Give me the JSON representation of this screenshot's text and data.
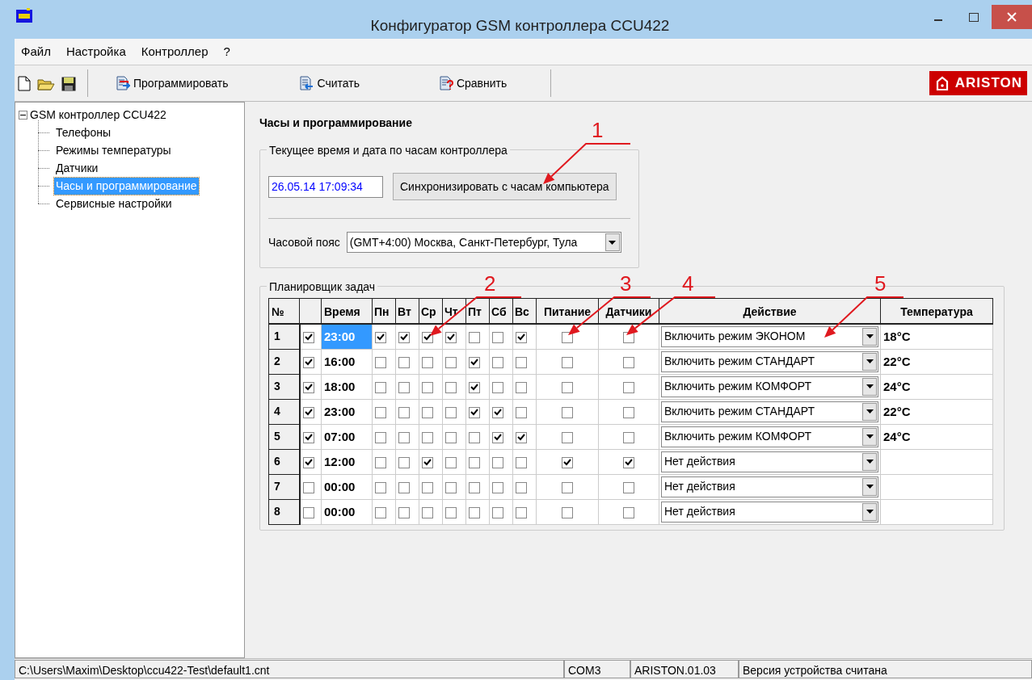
{
  "window": {
    "title": "Конфигуратор GSM контроллера CCU422"
  },
  "menu": [
    {
      "label": "Файл"
    },
    {
      "label": "Настройка"
    },
    {
      "label": "Контроллер"
    },
    {
      "label": "?"
    }
  ],
  "toolbar": {
    "buttons": [
      {
        "label": "Программировать",
        "kind": "program"
      },
      {
        "label": "Считать",
        "kind": "read"
      },
      {
        "label": "Сравнить",
        "kind": "compare"
      }
    ],
    "brand": "ARISTON"
  },
  "tree": {
    "label": "GSM контроллер CCU422",
    "expanded": true,
    "children": [
      {
        "label": "Телефоны",
        "selected": false
      },
      {
        "label": "Режимы температуры",
        "selected": false
      },
      {
        "label": "Датчики",
        "selected": false
      },
      {
        "label": "Часы и программирование",
        "selected": true
      },
      {
        "label": "Сервисные настройки",
        "selected": false
      }
    ]
  },
  "panel": {
    "title": "Часы и программирование",
    "clock_group": {
      "legend": "Текущее время и дата по часам контроллера",
      "datetime": "26.05.14 17:09:34",
      "sync_button": "Синхронизировать с часам компьютера",
      "timezone_label": "Часовой пояс",
      "timezone": "(GMT+4:00) Москва, Санкт-Петербург, Тула"
    },
    "scheduler": {
      "legend": "Планировщик задач",
      "columns": [
        "№",
        "Время",
        "Пн",
        "Вт",
        "Ср",
        "Чт",
        "Пт",
        "Сб",
        "Вс",
        "Питание",
        "Датчики",
        "Действие",
        "Температура"
      ],
      "rows": [
        {
          "number": "1",
          "enabled": true,
          "time": "23:00",
          "selected": true,
          "days": [
            true,
            true,
            true,
            true,
            false,
            false,
            true
          ],
          "power": false,
          "sensors": false,
          "action": "Включить режим ЭКОНОМ",
          "temperature": "18°C"
        },
        {
          "number": "2",
          "enabled": true,
          "time": "16:00",
          "selected": false,
          "days": [
            false,
            false,
            false,
            false,
            true,
            false,
            false
          ],
          "power": false,
          "sensors": false,
          "action": "Включить режим СТАНДАРТ",
          "temperature": "22°C"
        },
        {
          "number": "3",
          "enabled": true,
          "time": "18:00",
          "selected": false,
          "days": [
            false,
            false,
            false,
            false,
            true,
            false,
            false
          ],
          "power": false,
          "sensors": false,
          "action": "Включить режим КОМФОРТ",
          "temperature": "24°C"
        },
        {
          "number": "4",
          "enabled": true,
          "time": "23:00",
          "selected": false,
          "days": [
            false,
            false,
            false,
            false,
            true,
            true,
            false
          ],
          "power": false,
          "sensors": false,
          "action": "Включить режим СТАНДАРТ",
          "temperature": "22°C"
        },
        {
          "number": "5",
          "enabled": true,
          "time": "07:00",
          "selected": false,
          "days": [
            false,
            false,
            false,
            false,
            false,
            true,
            true
          ],
          "power": false,
          "sensors": false,
          "action": "Включить режим КОМФОРТ",
          "temperature": "24°C"
        },
        {
          "number": "6",
          "enabled": true,
          "time": "12:00",
          "selected": false,
          "days": [
            false,
            false,
            true,
            false,
            false,
            false,
            false
          ],
          "power": true,
          "sensors": true,
          "action": "Нет действия"
        },
        {
          "number": "7",
          "enabled": false,
          "time": "00:00",
          "selected": false,
          "days": [
            false,
            false,
            false,
            false,
            false,
            false,
            false
          ],
          "power": false,
          "sensors": false,
          "action": "Нет действия"
        },
        {
          "number": "8",
          "enabled": false,
          "time": "00:00",
          "selected": false,
          "days": [
            false,
            false,
            false,
            false,
            false,
            false,
            false
          ],
          "power": false,
          "sensors": false,
          "action": "Нет действия"
        }
      ]
    }
  },
  "annotations": [
    {
      "label": "1"
    },
    {
      "label": "2"
    },
    {
      "label": "3"
    },
    {
      "label": "4"
    },
    {
      "label": "5"
    }
  ],
  "status_bar": [
    {
      "text": "C:\\Users\\Maxim\\Desktop\\ccu422-Test\\default1.cnt"
    },
    {
      "text": "COM3"
    },
    {
      "text": "ARISTON.01.03"
    },
    {
      "text": "Версия устройства считана"
    }
  ]
}
